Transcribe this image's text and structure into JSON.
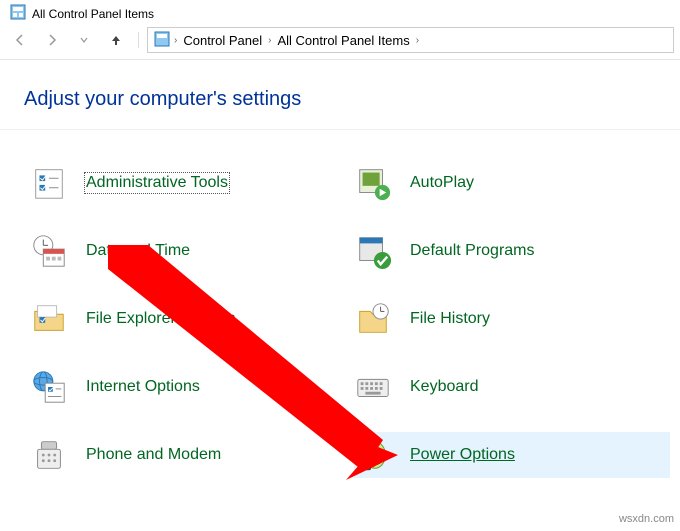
{
  "title": "All Control Panel Items",
  "breadcrumb": [
    "Control Panel",
    "All Control Panel Items"
  ],
  "heading": "Adjust your computer's settings",
  "items": [
    {
      "id": "admin-tools",
      "label": "Administrative Tools",
      "focused": true
    },
    {
      "id": "autoplay",
      "label": "AutoPlay"
    },
    {
      "id": "date-time",
      "label": "Date and Time"
    },
    {
      "id": "default-prog",
      "label": "Default Programs"
    },
    {
      "id": "file-explorer",
      "label": "File Explorer Options"
    },
    {
      "id": "file-history",
      "label": "File History"
    },
    {
      "id": "internet-opts",
      "label": "Internet Options"
    },
    {
      "id": "keyboard",
      "label": "Keyboard"
    },
    {
      "id": "phone-modem",
      "label": "Phone and Modem"
    },
    {
      "id": "power-opts",
      "label": "Power Options",
      "hover": true
    }
  ],
  "watermark": "wsxdn.com",
  "colors": {
    "link": "#006621",
    "heading": "#003399",
    "arrow": "#ff0000"
  }
}
